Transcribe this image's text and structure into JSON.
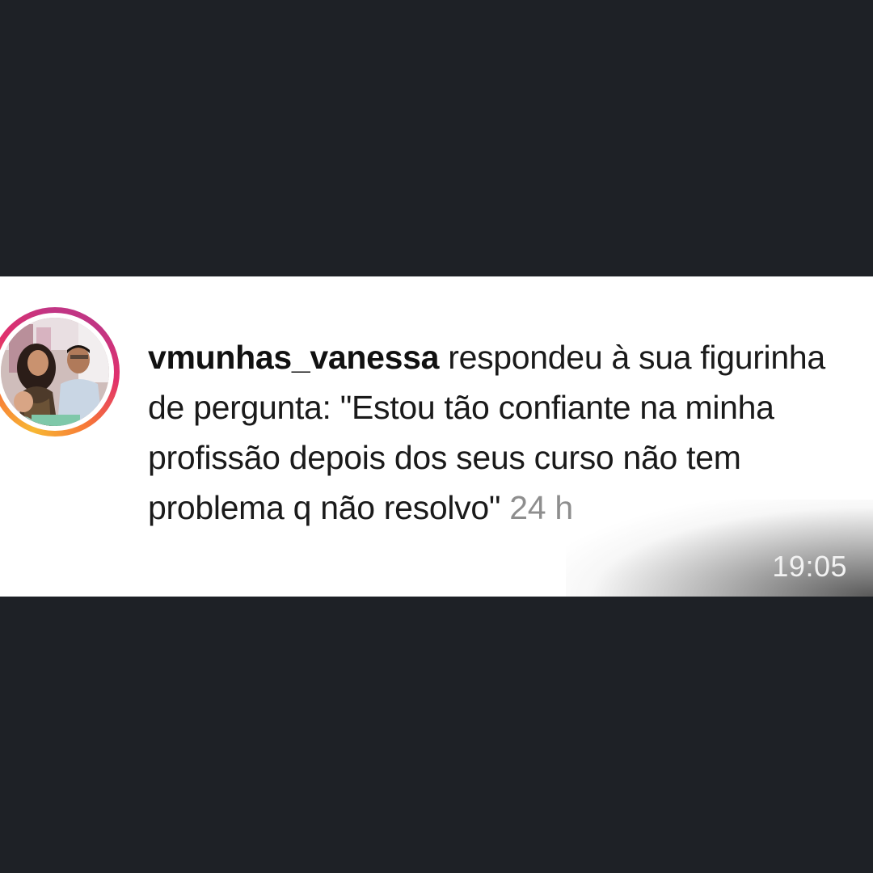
{
  "notification": {
    "username": "vmunhas_vanessa",
    "message": " respondeu à sua figurinha de pergunta: \"Estou tão confiante na minha profissão depois dos seus curso não tem problema q não resolvo\"",
    "time_ago": " 24 h"
  },
  "status": {
    "clock": "19:05"
  },
  "colors": {
    "background": "#1e2126",
    "card": "#ffffff",
    "text": "#1a1a1a",
    "muted": "#8e8e8e",
    "story_ring": [
      "#f7b733",
      "#f77737",
      "#e1306c",
      "#c13584"
    ]
  }
}
